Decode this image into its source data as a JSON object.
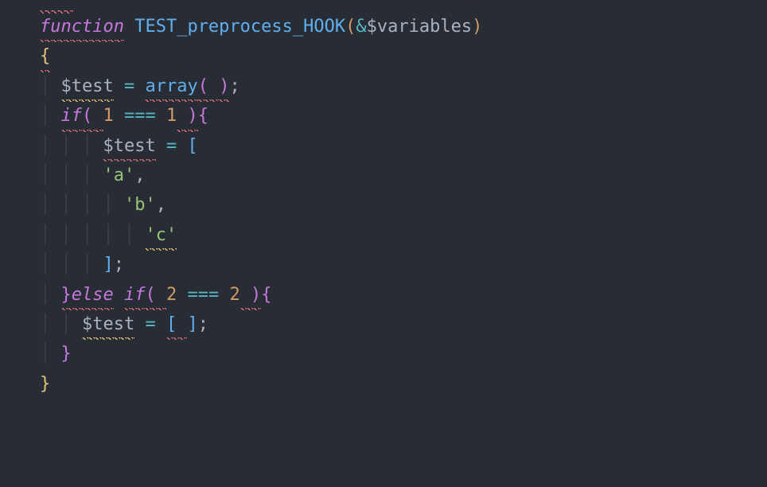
{
  "code": {
    "keyword_function": "function",
    "function_name": "TEST_preprocess_HOOK",
    "amp": "&",
    "param": "$variables",
    "var_test": "$test",
    "assign": " = ",
    "array_kw": "array",
    "if_kw": "if",
    "else_kw": "else",
    "num1": "1",
    "num2": "2",
    "strict_eq": " === ",
    "str_a": "'a'",
    "str_b": "'b'",
    "str_c": "'c'",
    "comma": ",",
    "semi": ";",
    "open_paren": "(",
    "close_paren": ")",
    "open_brace": "{",
    "close_brace": "}",
    "open_bracket": "[",
    "close_bracket": "]",
    "space": " ",
    "open_bracket_sp": "[ ",
    "close_paren_bracket": " )"
  }
}
